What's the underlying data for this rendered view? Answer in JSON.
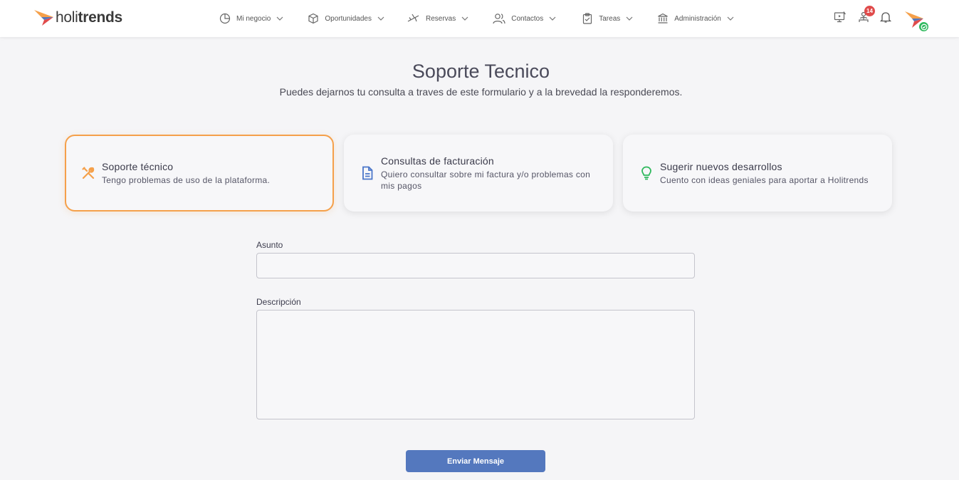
{
  "brand": {
    "name_light": "holi",
    "name_bold": "trends"
  },
  "nav": [
    {
      "label": "Mi negocio",
      "icon": "pie-chart-icon"
    },
    {
      "label": "Oportunidades",
      "icon": "cube-icon"
    },
    {
      "label": "Reservas",
      "icon": "plane-icon"
    },
    {
      "label": "Contactos",
      "icon": "users-icon"
    },
    {
      "label": "Tareas",
      "icon": "clipboard-icon"
    },
    {
      "label": "Administración",
      "icon": "bank-icon"
    }
  ],
  "topbar": {
    "notifications_count": "14"
  },
  "page": {
    "title": "Soporte Tecnico",
    "subtitle": "Puedes dejarnos tu consulta a traves de este formulario y a la brevedad la responderemos."
  },
  "cards": [
    {
      "title": "Soporte técnico",
      "desc": "Tengo problemas de uso de la plataforma.",
      "icon": "tools-icon",
      "active": true
    },
    {
      "title": "Consultas de facturación",
      "desc": "Quiero consultar sobre mi factura y/o problemas con mis pagos",
      "icon": "document-icon",
      "active": false
    },
    {
      "title": "Sugerir nuevos desarrollos",
      "desc": "Cuento con ideas geniales para aportar a Holitrends",
      "icon": "lightbulb-icon",
      "active": false
    }
  ],
  "form": {
    "subject_label": "Asunto",
    "subject_value": "",
    "description_label": "Descripción",
    "description_value": "",
    "submit_label": "Enviar Mensaje"
  },
  "colors": {
    "accent": "#f5a04a",
    "primary": "#5478be",
    "doc_icon": "#4a76c9",
    "idea_icon": "#2eb85c",
    "badge": "#e04b4b"
  }
}
